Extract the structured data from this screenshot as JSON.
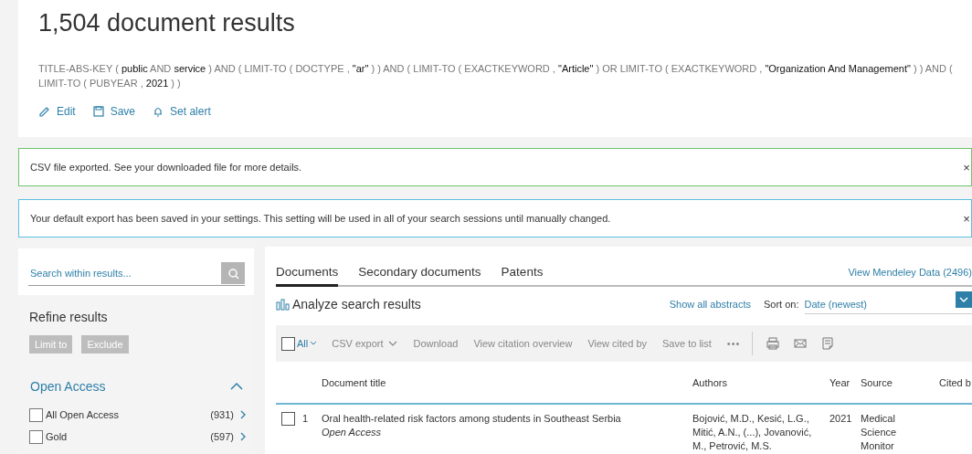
{
  "header": {
    "title": "1,504 document results",
    "query": [
      {
        "kind": "op",
        "text": "TITLE-ABS-KEY ("
      },
      {
        "kind": "term",
        "text": "public"
      },
      {
        "kind": "op",
        "text": "AND"
      },
      {
        "kind": "term",
        "text": "service"
      },
      {
        "kind": "op",
        "text": ") AND ( LIMIT-TO ( DOCTYPE ,"
      },
      {
        "kind": "term",
        "text": "\"ar\""
      },
      {
        "kind": "op",
        "text": ") ) AND ( LIMIT-TO ( EXACTKEYWORD ,"
      },
      {
        "kind": "term",
        "text": "\"Article\""
      },
      {
        "kind": "op",
        "text": ") OR LIMIT-TO ( EXACTKEYWORD ,"
      },
      {
        "kind": "term",
        "text": "\"Organization And Management\""
      },
      {
        "kind": "op",
        "text": ") ) AND ( LIMIT-TO ( PUBYEAR ,"
      },
      {
        "kind": "term",
        "text": "2021"
      },
      {
        "kind": "op",
        "text": ") )"
      }
    ],
    "actions": [
      {
        "kind": "edit",
        "label": "Edit"
      },
      {
        "kind": "save",
        "label": "Save"
      },
      {
        "kind": "alert",
        "label": "Set alert"
      }
    ]
  },
  "alerts": [
    {
      "kind": "success",
      "message": "CSV file exported. See your downloaded file for more details.",
      "close": "×"
    },
    {
      "kind": "info",
      "message": "Your default export has been saved in your settings. This setting will be used in all of your search sessions until manually changed.",
      "close": "×"
    }
  ],
  "sidebar": {
    "search": {
      "placeholder": "Search within results..."
    },
    "refine_title": "Refine results",
    "buttons": [
      {
        "label": "Limit to",
        "disabled": true
      },
      {
        "label": "Exclude",
        "disabled": true
      }
    ],
    "facet": {
      "title": "Open Access",
      "expanded": true,
      "items": [
        {
          "label": "All Open Access",
          "count": "(931)",
          "checked": false
        },
        {
          "label": "Gold",
          "count": "(597)",
          "checked": false
        }
      ]
    }
  },
  "results": {
    "tabs": [
      {
        "label": "Documents",
        "selected": true
      },
      {
        "label": "Secondary documents",
        "selected": false
      },
      {
        "label": "Patents",
        "selected": false
      }
    ],
    "mendeley": "View Mendeley Data (2496)",
    "analyze": "Analyze search results",
    "show_abstracts": "Show all abstracts",
    "sort": {
      "label": "Sort on:",
      "value": "Date (newest)"
    },
    "toolbar": {
      "select_all": {
        "label": "All",
        "checked": false
      },
      "actions": [
        {
          "kind": "dropdown",
          "label": "CSV export"
        },
        {
          "kind": "link",
          "label": "Download"
        },
        {
          "kind": "link",
          "label": "View citation overview"
        },
        {
          "kind": "link",
          "label": "View cited by"
        },
        {
          "kind": "link",
          "label": "Save to list"
        }
      ],
      "more": "•••"
    },
    "table": {
      "columns": [
        "Document title",
        "Authors",
        "Year",
        "Source",
        "Cited b"
      ],
      "rows": [
        {
          "number": "1",
          "checked": false,
          "title": "Oral health-related risk factors among students in Southeast Serbia",
          "access": "Open Access",
          "authors": "Bojović, M.D., Kesić, L.G., Mitić, A.N., (...), Jovanović, M., Petrović, M.S.",
          "year": "2021",
          "source": "Medical Science Monitor"
        }
      ]
    }
  }
}
